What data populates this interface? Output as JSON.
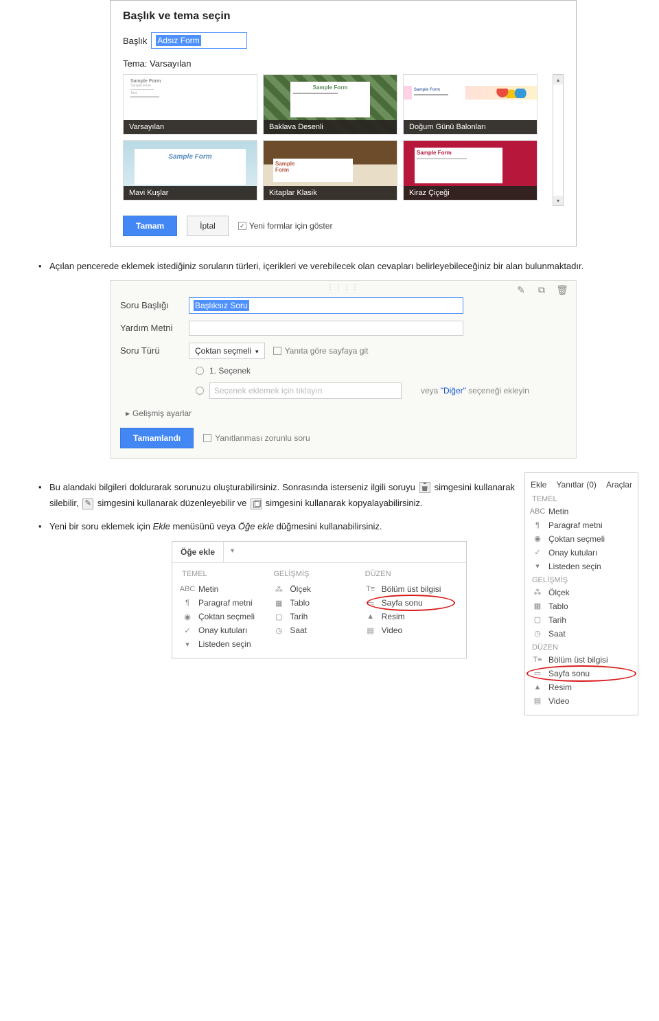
{
  "dialog1": {
    "title": "Başlık ve tema seçin",
    "title_label": "Başlık",
    "title_value": "Adsız Form",
    "theme_label": "Tema: Varsayılan",
    "sample": "Sample Form",
    "themes": [
      "Varsayılan",
      "Baklava Desenli",
      "Doğum Günü Balonları",
      "Mavi Kuşlar",
      "Kitaplar Klasik",
      "Kiraz Çiçeği"
    ],
    "btn_ok": "Tamam",
    "btn_cancel": "İptal",
    "cb_label": "Yeni formlar için göster"
  },
  "doc": {
    "p1": "Açılan pencerede eklemek istediğiniz soruların türleri, içerikleri ve verebilecek olan cevapları belirleyebileceğiniz bir alan bulunmaktadır.",
    "p2a": "Bu alandaki bilgileri doldurarak sorunuzu oluşturabilirsiniz. ",
    "p2b": "Sonrasında isterseniz ilgili soruyu ",
    "p2c": " simgesini kullanarak silebilir, ",
    "p2d": " simgesini kullanarak düzenleyebilir ve ",
    "p2e": " simgesini kullanarak kopyalayabilirsiniz.",
    "p3a": "Yeni bir soru eklemek için",
    "p3b": "Ekle",
    "p3c": "menüsünü veya",
    "p3d": "Öğe ekle",
    "p3e": "düğmesini kullanabilirsiniz."
  },
  "dialog2": {
    "q_title_label": "Soru Başlığı",
    "q_title_value": "Başlıksız Soru",
    "help_label": "Yardım Metni",
    "type_label": "Soru Türü",
    "type_value": "Çoktan seçmeli",
    "goto_label": "Yanıta göre sayfaya git",
    "opt1": "1. Seçenek",
    "opt_add_placeholder": "Seçenek eklemek için tıklayın",
    "or_prefix": "veya ",
    "other_link": "\"Diğer\"",
    "or_suffix": " seçeneği ekleyin",
    "advanced": "Gelişmiş ayarlar",
    "done": "Tamamlandı",
    "required": "Yanıtlanması zorunlu soru"
  },
  "dialog3": {
    "header": "Öğe ekle"
  },
  "menu": {
    "sec_basic": "TEMEL",
    "sec_adv": "GELİŞMİŞ",
    "sec_layout": "DÜZEN",
    "text": "Metin",
    "paragraph": "Paragraf metni",
    "multiplechoice": "Çoktan seçmeli",
    "checkboxes": "Onay kutuları",
    "list": "Listeden seçin",
    "scale": "Ölçek",
    "grid": "Tablo",
    "date": "Tarih",
    "time": "Saat",
    "sectionheader": "Bölüm üst bilgisi",
    "pagebreak": "Sayfa sonu",
    "image": "Resim",
    "video": "Video"
  },
  "rpanel": {
    "top1": "Ekle",
    "top2": "Yanıtlar (0)",
    "top3": "Araçlar"
  }
}
